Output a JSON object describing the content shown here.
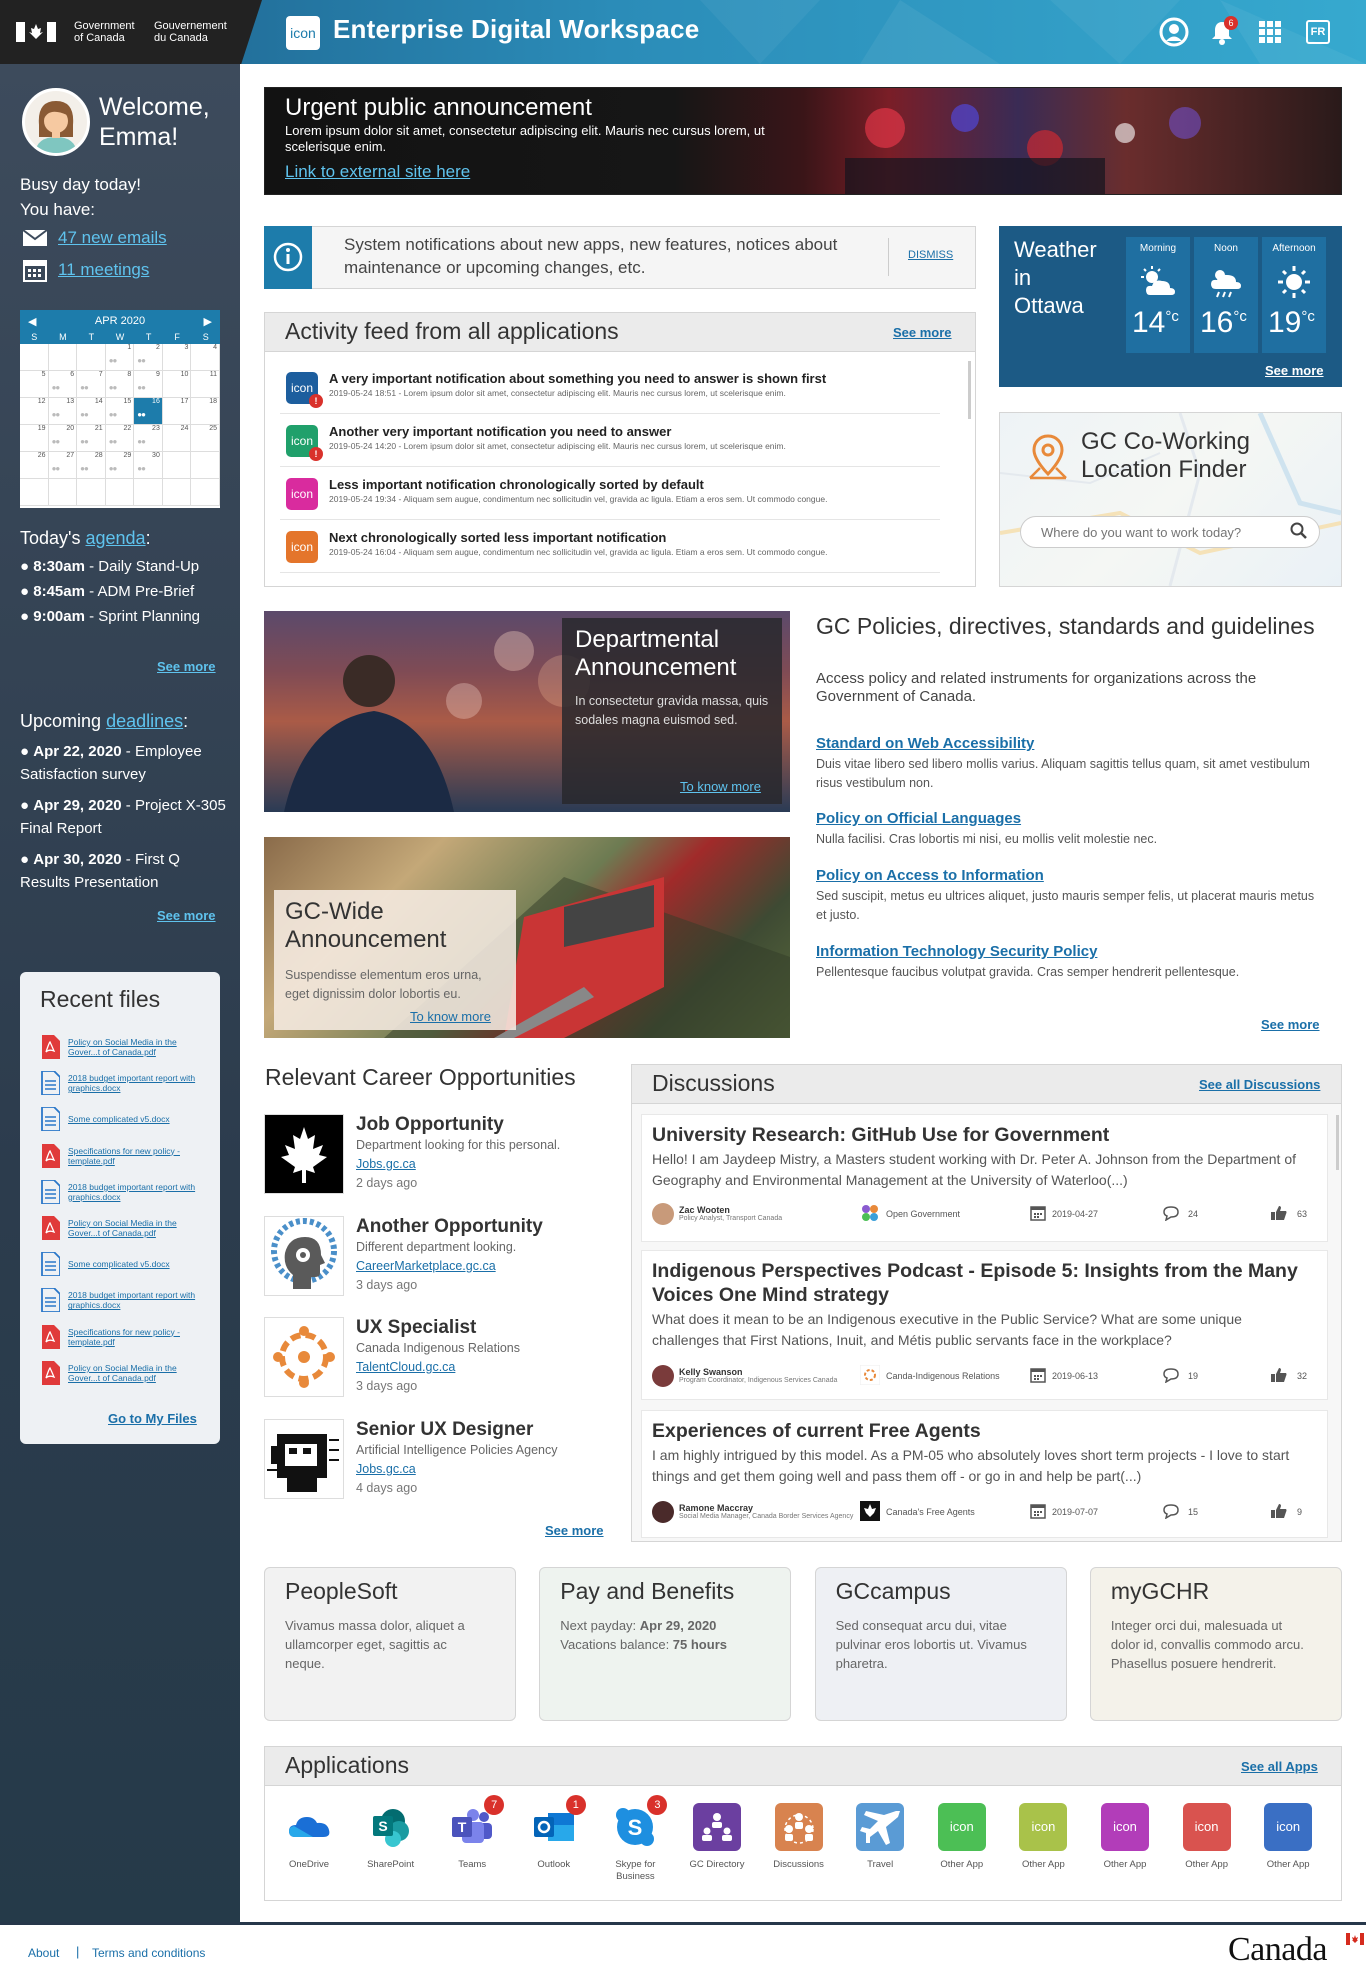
{
  "header": {
    "gov_en": [
      "Government",
      "of Canada"
    ],
    "gov_fr": [
      "Gouvernement",
      "du Canada"
    ],
    "app_icon": "icon",
    "title": "Enterprise Digital Workspace",
    "notif_count": "6",
    "lang": "FR"
  },
  "sidebar": {
    "welcome": "Welcome, Emma!",
    "busy": "Busy day today!",
    "you_have": "You have:",
    "emails": "47 new emails",
    "meetings": "11 meetings",
    "calendar": {
      "month": "APR 2020",
      "days": [
        "S",
        "M",
        "T",
        "W",
        "T",
        "F",
        "S"
      ],
      "cells": [
        "",
        "",
        "",
        "1",
        "2",
        "3",
        "4",
        "5",
        "6",
        "7",
        "8",
        "9",
        "10",
        "11",
        "12",
        "13",
        "14",
        "15",
        "16",
        "17",
        "18",
        "19",
        "20",
        "21",
        "22",
        "23",
        "24",
        "25",
        "26",
        "27",
        "28",
        "29",
        "30",
        "",
        "",
        "",
        "",
        "",
        "",
        "",
        "",
        ""
      ],
      "selected": "16"
    },
    "agenda_prefix": "Today's",
    "agenda_link": "agenda",
    "agenda_colon": ":",
    "agenda": [
      {
        "time": "8:30am",
        "text": " - Daily Stand-Up"
      },
      {
        "time": "8:45am",
        "text": " - ADM Pre-Brief"
      },
      {
        "time": "9:00am",
        "text": " - Sprint Planning"
      }
    ],
    "agenda_see": "See more",
    "deadlines_prefix": "Upcoming",
    "deadlines_link": "deadlines",
    "deadlines_colon": ":",
    "deadlines": [
      {
        "date": "Apr 22, 2020",
        "text": " - Employee Satisfaction survey"
      },
      {
        "date": "Apr 29, 2020",
        "text": " - Project X-305 Final Report"
      },
      {
        "date": "Apr 30, 2020",
        "text": " - First Q Results Presentation"
      }
    ],
    "deadlines_see": "See more",
    "recent_title": "Recent files",
    "recent_files": [
      {
        "type": "pdf",
        "name": "Policy on Social Media in the Gover...t of Canada.pdf"
      },
      {
        "type": "doc",
        "name": "2018 budget important report with graphics.docx"
      },
      {
        "type": "doc",
        "name": "Some complicated v5.docx"
      },
      {
        "type": "pdf",
        "name": "Specifications for new policy - template.pdf"
      },
      {
        "type": "doc",
        "name": "2018 budget important report with graphics.docx"
      },
      {
        "type": "pdf",
        "name": "Policy on Social Media in the Gover...t of Canada.pdf"
      },
      {
        "type": "doc",
        "name": "Some complicated v5.docx"
      },
      {
        "type": "doc",
        "name": "2018 budget important report with graphics.docx"
      },
      {
        "type": "pdf",
        "name": "Specifications for new policy - template.pdf"
      },
      {
        "type": "pdf",
        "name": "Policy on Social Media in the Gover...t of Canada.pdf"
      }
    ],
    "goto_files": "Go to My Files"
  },
  "urgent": {
    "title": "Urgent public announcement",
    "desc": "Lorem ipsum dolor sit amet, consectetur adipiscing elit. Mauris nec cursus lorem, ut scelerisque enim.",
    "link": "Link to external site here"
  },
  "sysnote": {
    "text": "System notifications about new apps, new features, notices about maintenance or upcoming changes, etc.",
    "dismiss": "DISMISS"
  },
  "feed": {
    "title": "Activity feed from all applications",
    "see": "See more",
    "items": [
      {
        "icon": "icon",
        "color": "#1d5e9e",
        "alert": "!",
        "title": "A very important notification about something you need to answer is shown first",
        "desc": "2019-05-24 18:51 - Lorem ipsum dolor sit amet, consectetur adipiscing elit. Mauris nec cursus lorem, ut scelerisque enim."
      },
      {
        "icon": "icon",
        "color": "#20a06b",
        "alert": "!",
        "title": "Another very important notification you need to answer",
        "desc": "2019-05-24 14:20 - Lorem ipsum dolor sit amet, consectetur adipiscing elit. Mauris nec cursus lorem, ut scelerisque enim."
      },
      {
        "icon": "icon",
        "color": "#d92b9e",
        "alert": "",
        "title": "Less important notification chronologically sorted by default",
        "desc": "2019-05-24 19:34 - Aliquam sem augue, condimentum nec sollicitudin vel, gravida ac ligula. Etiam a eros sem. Ut commodo congue."
      },
      {
        "icon": "icon",
        "color": "#e4752b",
        "alert": "",
        "title": "Next chronologically sorted less important notification",
        "desc": "2019-05-24 16:04 - Aliquam sem augue, condimentum nec sollicitudin vel, gravida ac ligula. Etiam a eros sem. Ut commodo congue."
      }
    ]
  },
  "weather": {
    "title": "Weather in Ottawa",
    "cols": [
      {
        "label": "Morning",
        "temp": "14",
        "icon": "partly-cloudy-icon"
      },
      {
        "label": "Noon",
        "temp": "16",
        "icon": "rain-cloud-icon"
      },
      {
        "label": "Afternoon",
        "temp": "19",
        "icon": "sun-icon"
      }
    ],
    "unit": "°c",
    "see": "See more"
  },
  "finder": {
    "title": "GC Co-Working Location Finder",
    "placeholder": "Where do you want to work today?"
  },
  "dept": {
    "title": "Departmental Announcement",
    "desc": "In consectetur gravida massa, quis sodales magna euismod sed.",
    "link": "To know more"
  },
  "gcwide": {
    "title": "GC-Wide Announcement",
    "desc": "Suspendisse elementum eros urna, eget dignissim dolor lobortis eu.",
    "link": "To know more"
  },
  "policies": {
    "title": "GC Policies, directives, standards and guidelines",
    "subtitle": "Access policy and related instruments for organizations across the Government of Canada.",
    "items": [
      {
        "link": "Standard on Web Accessibility",
        "desc": "Duis vitae libero sed libero mollis varius. Aliquam sagittis tellus quam, sit amet vestibulum risus vestibulum non."
      },
      {
        "link": "Policy on Official Languages",
        "desc": "Nulla facilisi. Cras lobortis mi nisi, eu mollis velit molestie nec."
      },
      {
        "link": "Policy on Access to Information",
        "desc": "Sed suscipit, metus eu ultrices aliquet, justo mauris semper felis, ut placerat mauris metus et justo."
      },
      {
        "link": "Information Technology Security Policy",
        "desc": "Pellentesque faucibus volutpat gravida. Cras semper hendrerit pellentesque."
      }
    ],
    "see": "See more"
  },
  "careers": {
    "title": "Relevant Career Opportunities",
    "items": [
      {
        "title": "Job Opportunity",
        "desc": "Department looking for this personal.",
        "link": "Jobs.gc.ca",
        "ago": "2 days ago",
        "img": "maple-leaf-icon"
      },
      {
        "title": "Another Opportunity",
        "desc": "Different department looking.",
        "link": "CareerMarketplace.gc.ca",
        "ago": "3 days ago",
        "img": "gears-head-icon"
      },
      {
        "title": "UX Specialist",
        "desc": "Canada Indigenous Relations",
        "link": "TalentCloud.gc.ca",
        "ago": "3 days ago",
        "img": "people-circle-icon"
      },
      {
        "title": "Senior UX Designer",
        "desc": "Artificial Intelligence Policies Agency",
        "link": "Jobs.gc.ca",
        "ago": "4 days ago",
        "img": "robot-head-icon"
      }
    ],
    "see": "See more"
  },
  "discussions": {
    "title": "Discussions",
    "see": "See all Discussions",
    "items": [
      {
        "title": "University Research: GitHub Use for Government",
        "body": "Hello! I am Jaydeep Mistry, a Masters student working with Dr. Peter A. Johnson from the Department of Geography and Environmental Management at the University of Waterloo(...)",
        "author": "Zac Wooten",
        "role": "Policy Analyst, Transport Canada",
        "category": "Open Government",
        "date": "2019-04-27",
        "comments": "24",
        "likes": "63"
      },
      {
        "title": "Indigenous Perspectives Podcast - Episode 5: Insights from the Many Voices One Mind strategy",
        "body": "What does it mean to be an Indigenous executive in the Public Service? What are some unique challenges that First Nations, Inuit, and Métis public servants face in the workplace?",
        "author": "Kelly Swanson",
        "role": "Program Coordinator, Indigenous Services Canada",
        "category": "Canda-Indigenous Relations",
        "date": "2019-06-13",
        "comments": "19",
        "likes": "32"
      },
      {
        "title": "Experiences of current Free Agents",
        "body": "I am highly intrigued by this model.  As a PM-05 who absolutely loves short term projects - I love to start things and get them going well and pass them off - or go in and help be part(...)",
        "author": "Ramone Maccray",
        "role": "Social Media Manager, Canada Border Services Agency",
        "category": "Canada's Free Agents",
        "date": "2019-07-07",
        "comments": "15",
        "likes": "9"
      }
    ]
  },
  "tiles": [
    {
      "title": "PeopleSoft",
      "desc": "Vivamus massa dolor, aliquet a ullamcorper eget, sagittis ac neque.",
      "bg": "#f2f2f2"
    },
    {
      "title": "Pay and Benefits",
      "line1_label": "Next payday: ",
      "line1_value": "Apr 29, 2020",
      "line2_label": "Vacations balance: ",
      "line2_value": "75 hours",
      "bg": "#eef3ef"
    },
    {
      "title": "GCcampus",
      "desc": "Sed consequat arcu dui, vitae pulvinar eros lobortis ut. Vivamus pharetra.",
      "bg": "#eef0f4"
    },
    {
      "title": "myGCHR",
      "desc": "Integer orci dui, malesuada ut dolor id, convallis commodo arcu. Phasellus posuere hendrerit.",
      "bg": "#f4f2ea"
    }
  ],
  "applications": {
    "title": "Applications",
    "see": "See all Apps",
    "items": [
      {
        "name": "OneDrive",
        "color": "#ffffff",
        "icon": "onedrive-icon",
        "badge": ""
      },
      {
        "name": "SharePoint",
        "color": "#ffffff",
        "icon": "sharepoint-icon",
        "badge": ""
      },
      {
        "name": "Teams",
        "color": "#ffffff",
        "icon": "teams-icon",
        "badge": "7"
      },
      {
        "name": "Outlook",
        "color": "#ffffff",
        "icon": "outlook-icon",
        "badge": "1"
      },
      {
        "name": "Skype for Business",
        "color": "#ffffff",
        "icon": "skype-icon",
        "badge": "3"
      },
      {
        "name": "GC Directory",
        "color": "#6b3fa0",
        "icon": "directory-icon",
        "badge": ""
      },
      {
        "name": "Discussions",
        "color": "#d8834f",
        "icon": "discussions-icon",
        "badge": ""
      },
      {
        "name": "Travel",
        "color": "#5a9bd5",
        "icon": "airplane-icon",
        "badge": ""
      },
      {
        "name": "Other App",
        "color": "#4cbf55",
        "text": "icon",
        "badge": ""
      },
      {
        "name": "Other App",
        "color": "#a9c24a",
        "text": "icon",
        "badge": ""
      },
      {
        "name": "Other App",
        "color": "#b23db9",
        "text": "icon",
        "badge": ""
      },
      {
        "name": "Other App",
        "color": "#d9534f",
        "text": "icon",
        "badge": ""
      },
      {
        "name": "Other App",
        "color": "#3a6fc4",
        "text": "icon",
        "badge": ""
      }
    ]
  },
  "footer": {
    "about": "About",
    "sep": "|",
    "terms": "Terms and conditions",
    "wordmark": "Canada"
  }
}
